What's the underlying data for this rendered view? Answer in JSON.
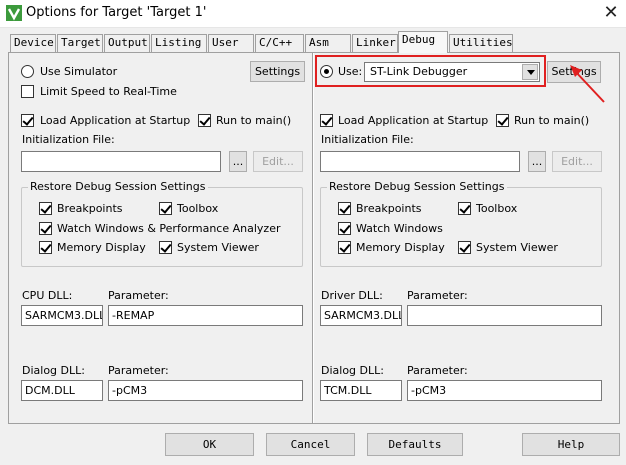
{
  "window": {
    "title": "Options for Target 'Target 1'",
    "close_glyph": "✕",
    "icon": "uvision-icon"
  },
  "tabs": [
    "Device",
    "Target",
    "Output",
    "Listing",
    "User",
    "C/C++",
    "Asm",
    "Linker",
    "Debug",
    "Utilities"
  ],
  "active_tab": "Debug",
  "left": {
    "use_simulator": "Use Simulator",
    "settings": "Settings",
    "limit_speed": "Limit Speed to Real-Time",
    "load_app": "Load Application at Startup",
    "run_to_main": "Run to main()",
    "init_file_label": "Initialization File:",
    "init_file_value": "",
    "browse": "...",
    "edit": "Edit...",
    "restore_group": "Restore Debug Session Settings",
    "breakpoints": "Breakpoints",
    "toolbox": "Toolbox",
    "watch_windows": "Watch Windows & Performance Analyzer",
    "memory_display": "Memory Display",
    "system_viewer": "System Viewer",
    "cpu_dll_label": "CPU DLL:",
    "cpu_dll_value": "SARMCM3.DLL",
    "cpu_param_label": "Parameter:",
    "cpu_param_value": "-REMAP",
    "dialog_dll_label": "Dialog DLL:",
    "dialog_dll_value": "DCM.DLL",
    "dialog_param_label": "Parameter:",
    "dialog_param_value": "-pCM3"
  },
  "right": {
    "use_label": "Use:",
    "debugger": "ST-Link Debugger",
    "settings": "Settings",
    "load_app": "Load Application at Startup",
    "run_to_main": "Run to main()",
    "init_file_label": "Initialization File:",
    "init_file_value": "",
    "browse": "...",
    "edit": "Edit...",
    "restore_group": "Restore Debug Session Settings",
    "breakpoints": "Breakpoints",
    "toolbox": "Toolbox",
    "watch_windows": "Watch Windows",
    "memory_display": "Memory Display",
    "system_viewer": "System Viewer",
    "driver_dll_label": "Driver DLL:",
    "driver_dll_value": "SARMCM3.DLL",
    "driver_param_label": "Parameter:",
    "driver_param_value": "",
    "dialog_dll_label": "Dialog DLL:",
    "dialog_dll_value": "TCM.DLL",
    "dialog_param_label": "Parameter:",
    "dialog_param_value": "-pCM3"
  },
  "footer": {
    "ok": "OK",
    "cancel": "Cancel",
    "defaults": "Defaults",
    "help": "Help"
  },
  "colors": {
    "highlight": "#e02020",
    "background": "#f0f0f0",
    "icon_green": "#3c9a3c"
  }
}
